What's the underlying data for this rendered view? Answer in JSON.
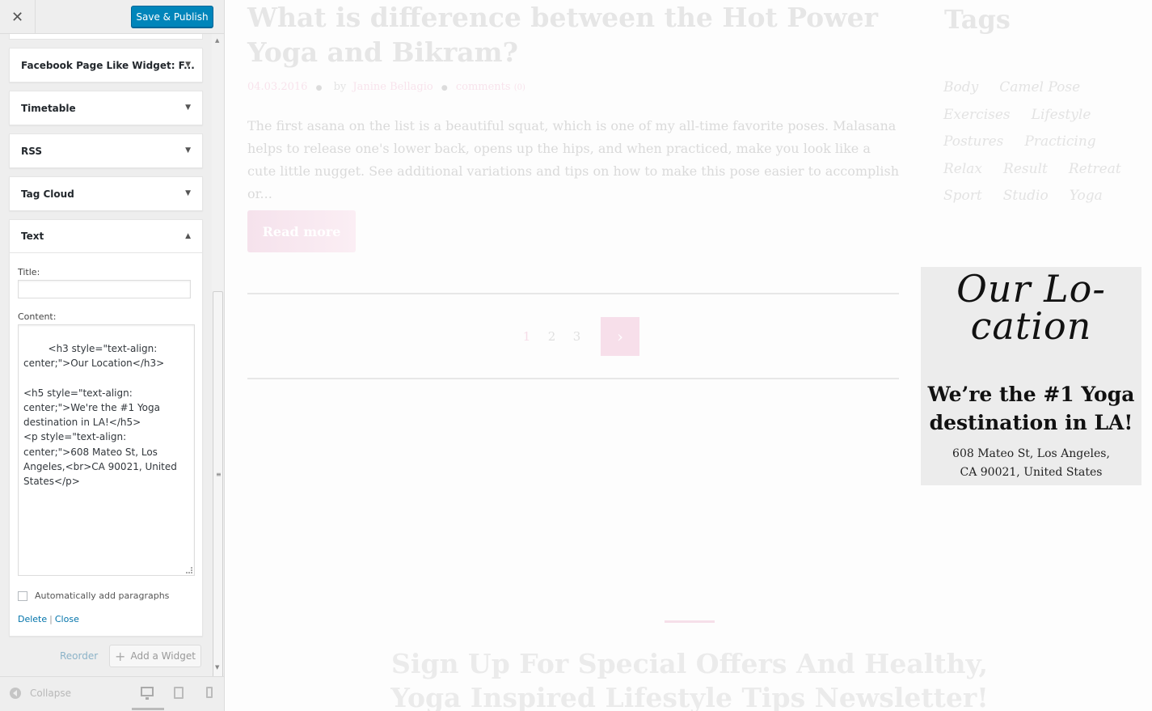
{
  "customizer": {
    "close_icon": "close-icon",
    "publish_label": "Save & Publish",
    "widgets": [
      {
        "label": "Facebook Page Like Widget: F..."
      },
      {
        "label": "Timetable"
      },
      {
        "label": "RSS"
      },
      {
        "label": "Tag Cloud"
      }
    ],
    "text_widget": {
      "label": "Text",
      "title_label": "Title:",
      "title_value": "",
      "content_label": "Content:",
      "content_value": "<h3 style=\"text-align: center;\">Our Location</h3>\n\n<h5 style=\"text-align: center;\">We're the #1 Yoga destination in LA!</h5>\n<p style=\"text-align: center;\">608 Mateo St, Los Angeles,<br>CA 90021, United States</p>",
      "auto_paragraphs_label": "Automatically add paragraphs",
      "auto_paragraphs_checked": false,
      "delete_label": "Delete",
      "separator": "|",
      "close_label": "Close"
    },
    "reorder_label": "Reorder",
    "add_widget_label": "Add a Widget",
    "collapse_label": "Collapse",
    "devices": [
      "desktop-icon",
      "tablet-icon",
      "mobile-icon"
    ]
  },
  "preview": {
    "post": {
      "title": "What is difference between the Hot Power Yoga and Bikram?",
      "date": "04.03.2016",
      "by": "by",
      "author": "Janine Bellagio",
      "comments": "comments",
      "comments_count": "(0)",
      "excerpt": "The first asana on the list is a beautiful squat, which is one of my all-time favorite poses. Malasana helps to release one's lower back, opens up the hips, and when practiced, make you look like a cute little nugget. See additional variations and tips on how to make this pose easier to accomplish or...",
      "read_more": "Read more"
    },
    "pagination": {
      "pages": [
        "1",
        "2",
        "3"
      ],
      "next_icon": "chevron-right-icon"
    },
    "tags": {
      "heading": "Tags",
      "rows": [
        [
          "Body",
          "Camel Pose"
        ],
        [
          "Exercises",
          "Lifestyle"
        ],
        [
          "Postures",
          "Practicing"
        ],
        [
          "Relax",
          "Result",
          "Retreat"
        ],
        [
          "Sport",
          "Studio",
          "Yoga"
        ]
      ]
    },
    "location": {
      "script_line1": "Our Lo-",
      "script_line2": "cation",
      "tagline": "We’re the #1 Yoga destination in LA!",
      "address_line1": "608 Mateo St, Los Angeles,",
      "address_line2": "CA 90021, United States"
    },
    "signup": {
      "heading_line1": "Sign Up For Special Offers And Healthy,",
      "heading_line2": "Yoga Inspired Lifestyle Tips Newsletter!"
    },
    "colors": {
      "accent_pink": "#f7dfea",
      "publish_blue": "#0085ba",
      "link_blue": "#0073aa"
    }
  }
}
